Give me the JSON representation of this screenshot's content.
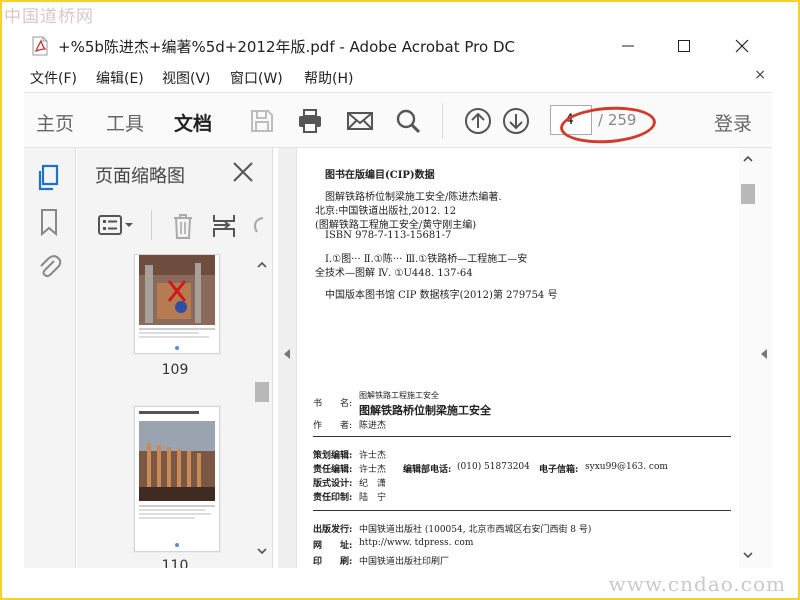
{
  "watermark": {
    "top": "中国道桥网",
    "bottom": "www.cndao.com"
  },
  "window": {
    "title": "+%5b陈进杰+编著%5d+2012年版.pdf - Adobe Acrobat Pro DC"
  },
  "menu": {
    "items": [
      "文件(F)",
      "编辑(E)",
      "视图(V)",
      "窗口(W)",
      "帮助(H)"
    ],
    "close_glyph": "×"
  },
  "toolbar": {
    "tabs": [
      {
        "label": "主页",
        "active": false
      },
      {
        "label": "工具",
        "active": false
      },
      {
        "label": "文档",
        "active": true
      }
    ],
    "page_current": "4",
    "page_total": "/ 259",
    "login": "登录",
    "icons": [
      "save-icon",
      "print-icon",
      "mail-icon",
      "search-icon",
      "page-up-icon",
      "page-down-icon"
    ]
  },
  "colors": {
    "frame": "#f6d12b",
    "annotation": "#d23b2c",
    "pdf_red": "#c8302b"
  },
  "sidebar": {
    "panel_title": "页面缩略图",
    "rail_icons": [
      "pages-icon",
      "bookmark-icon",
      "attachment-icon"
    ]
  },
  "thumbnails": [
    {
      "label": "109"
    },
    {
      "label": "110"
    }
  ],
  "document": {
    "cip_heading": "图书在版编目(CIP)数据",
    "cip_lines": [
      "图解铁路桥位制梁施工安全/陈进杰编著.",
      "北京:中国铁道出版社,2012. 12",
      "(图解铁路工程施工安全/黄守刚主编)",
      "ISBN 978-7-113-15681-7"
    ],
    "classification": [
      "Ⅰ.①图···  Ⅱ.①陈···  Ⅲ.①铁路桥—工程施工—安",
      "全技术—图解  Ⅳ. ①U448. 137-64"
    ],
    "cip_number": "中国版本图书馆 CIP 数据核字(2012)第 279754 号",
    "series_label": "书　　名:",
    "series_name": "图解铁路工程施工安全",
    "book_title": "图解铁路桥位制梁施工安全",
    "author_label": "作　　者:",
    "author": "陈进杰",
    "credits": [
      {
        "label": "策划编辑:",
        "value": "许士杰"
      },
      {
        "label": "责任编辑:",
        "value": "许士杰"
      },
      {
        "label": "版式设计:",
        "value": "纪　潇"
      },
      {
        "label": "责任印制:",
        "value": "陆　宁"
      }
    ],
    "dept_phone_label": "编辑部电话:",
    "dept_phone": "(010) 51873204",
    "email_label": "电子信箱:",
    "email": "syxu99@163. com",
    "publisher_label": "出版发行:",
    "publisher": "中国铁道出版社 (100054, 北京市西城区右安门西街 8 号)",
    "website_label": "网　　址:",
    "website": "http://www. tdpress. com",
    "printer_label": "印　　刷:",
    "printer": "中国铁道出版社印刷厂"
  }
}
